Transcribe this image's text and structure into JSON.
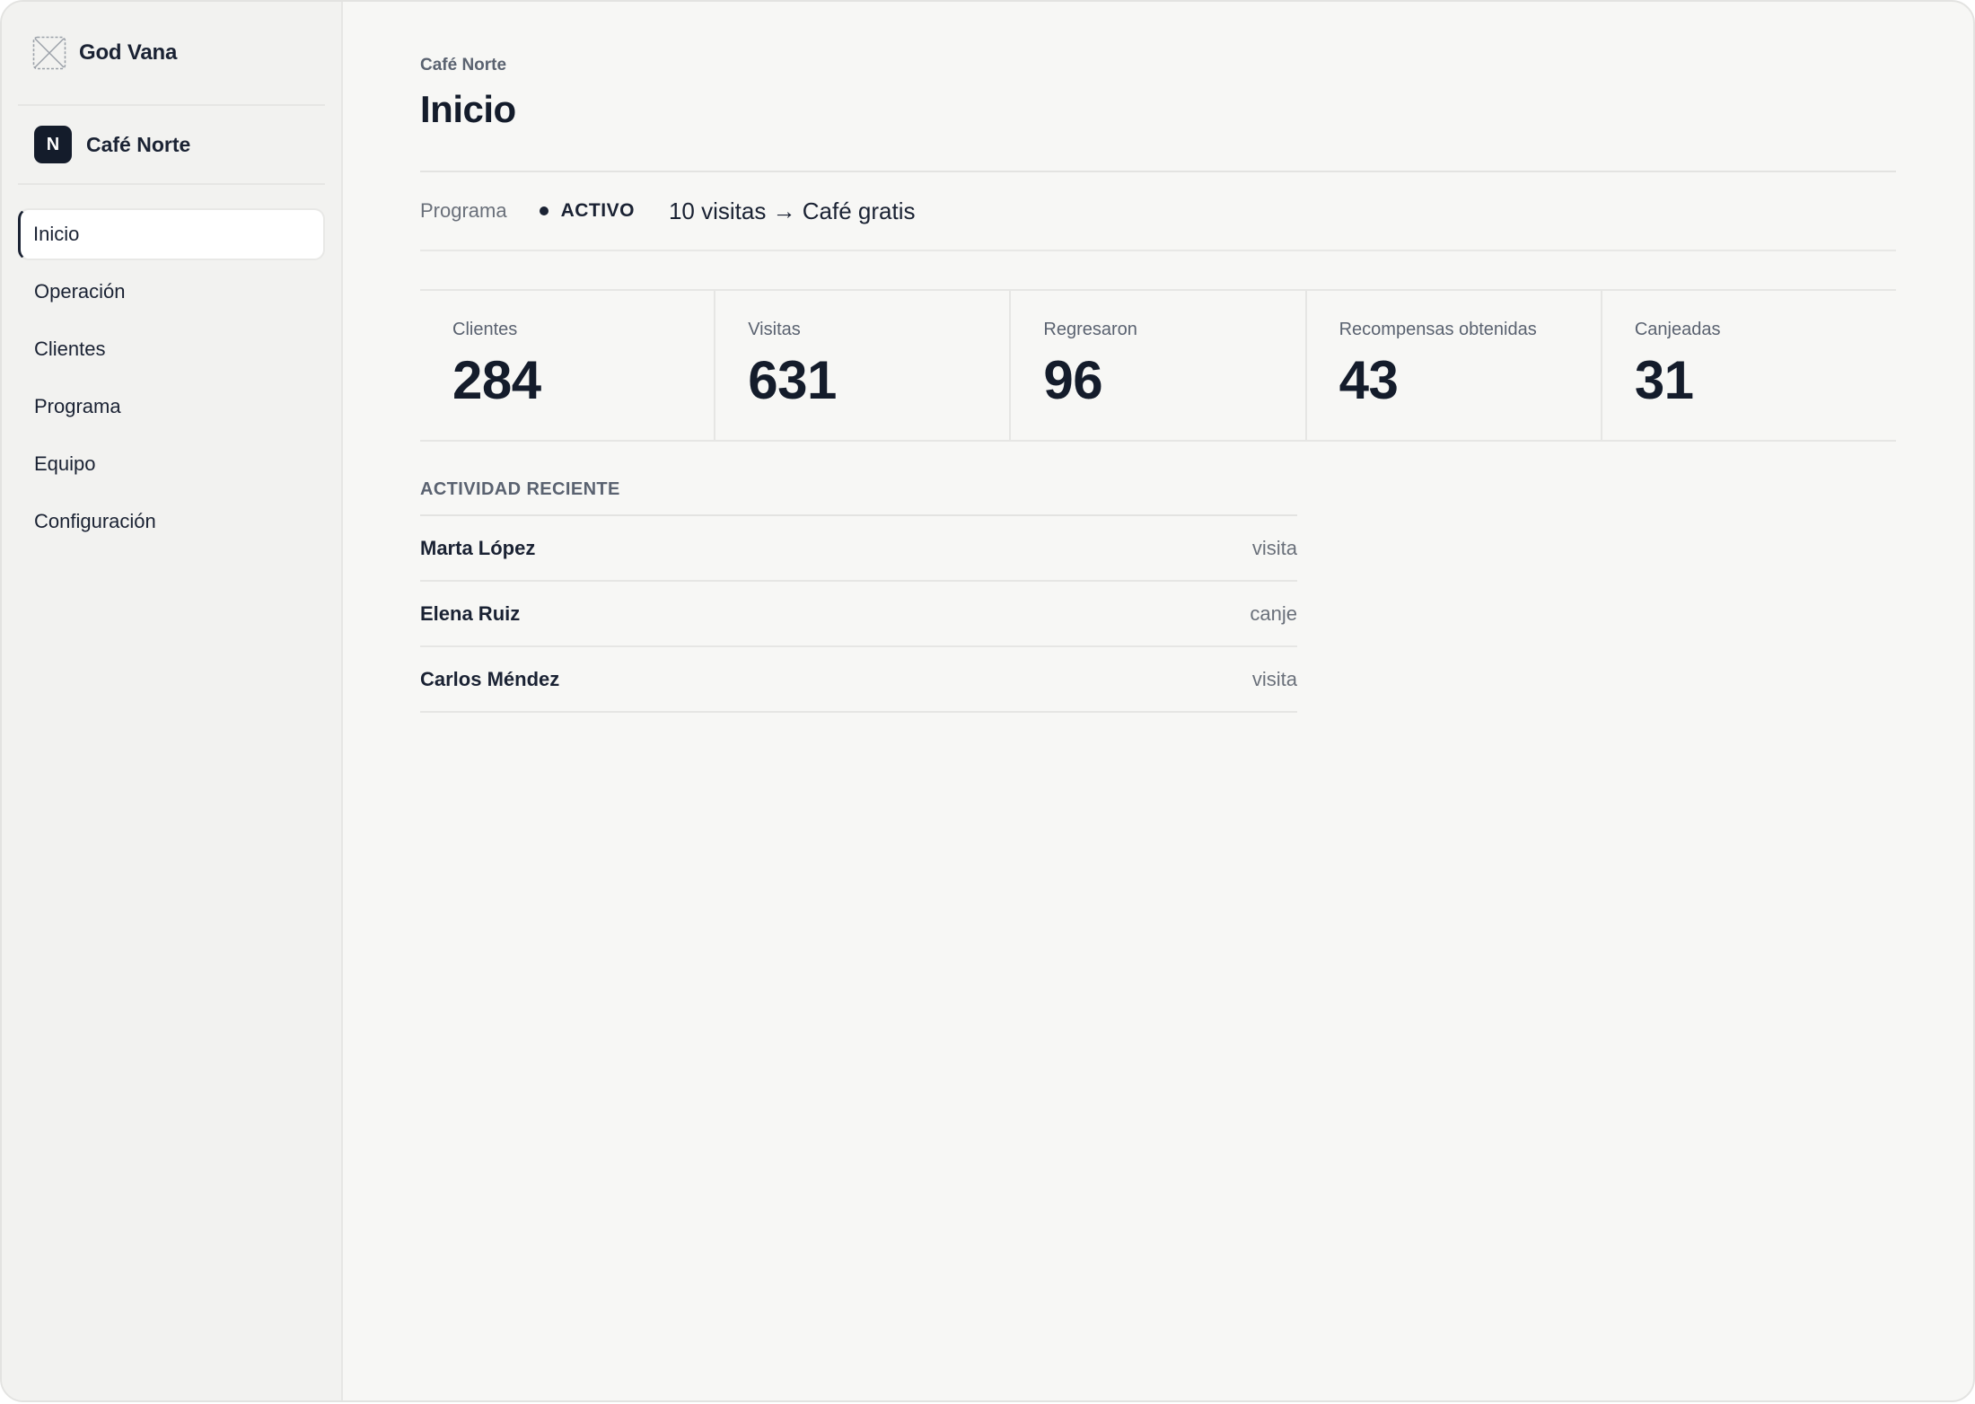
{
  "app": {
    "brand_name": "God Vana",
    "logo_icon": "placeholder-logo-icon"
  },
  "org": {
    "initial": "N",
    "name": "Café Norte"
  },
  "sidebar": {
    "items": [
      {
        "label": "Inicio",
        "active": true
      },
      {
        "label": "Operación",
        "active": false
      },
      {
        "label": "Clientes",
        "active": false
      },
      {
        "label": "Programa",
        "active": false
      },
      {
        "label": "Equipo",
        "active": false
      },
      {
        "label": "Configuración",
        "active": false
      }
    ]
  },
  "header": {
    "breadcrumb": "Café Norte",
    "title": "Inicio"
  },
  "program": {
    "label": "Programa",
    "status": "ACTIVO",
    "description": "10 visitas → Café gratis"
  },
  "stats": [
    {
      "label": "Clientes",
      "value": "284"
    },
    {
      "label": "Visitas",
      "value": "631"
    },
    {
      "label": "Regresaron",
      "value": "96"
    },
    {
      "label": "Recompensas obtenidas",
      "value": "43"
    },
    {
      "label": "Canjeadas",
      "value": "31"
    }
  ],
  "activity": {
    "title": "ACTIVIDAD RECIENTE",
    "rows": [
      {
        "name": "Marta López",
        "type": "visita"
      },
      {
        "name": "Elena Ruiz",
        "type": "canje"
      },
      {
        "name": "Carlos Méndez",
        "type": "visita"
      }
    ]
  },
  "colors": {
    "accent": "#141c2b",
    "background": "#f7f7f5",
    "sidebar_bg": "#f2f2f0"
  }
}
